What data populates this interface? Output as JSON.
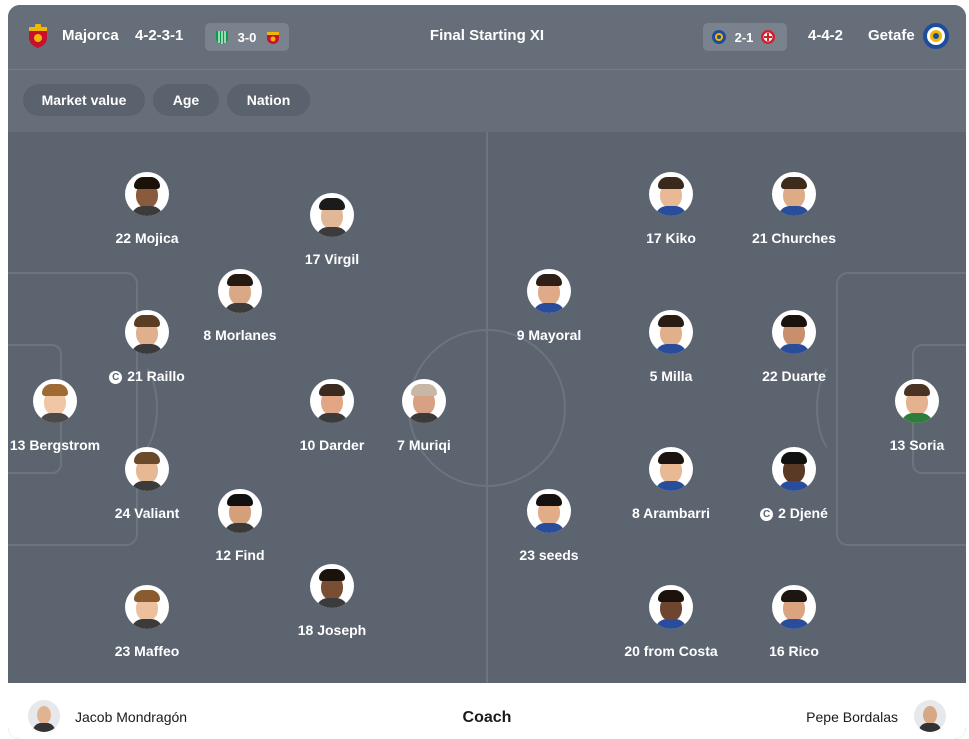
{
  "header": {
    "home_team": "Majorca",
    "home_formation": "4-2-3-1",
    "home_last_score": "3-0",
    "title": "Final Starting XI",
    "away_last_score": "2-1",
    "away_formation": "4-4-2",
    "away_team": "Getafe"
  },
  "filters": [
    "Market value",
    "Age",
    "Nation"
  ],
  "players": [
    {
      "label": "22 Mojica",
      "captain": false
    },
    {
      "label": "17 Virgil",
      "captain": false
    },
    {
      "label": "8 Morlanes",
      "captain": false
    },
    {
      "label": "21 Raillo",
      "captain": true
    },
    {
      "label": "13 Bergstrom",
      "captain": false
    },
    {
      "label": "10 Darder",
      "captain": false
    },
    {
      "label": "7 Muriqi",
      "captain": false
    },
    {
      "label": "24 Valiant",
      "captain": false
    },
    {
      "label": "12 Find",
      "captain": false
    },
    {
      "label": "23 Maffeo",
      "captain": false
    },
    {
      "label": "18 Joseph",
      "captain": false
    },
    {
      "label": "17 Kiko",
      "captain": false
    },
    {
      "label": "21 Churches",
      "captain": false
    },
    {
      "label": "9 Mayoral",
      "captain": false
    },
    {
      "label": "5 Milla",
      "captain": false
    },
    {
      "label": "22 Duarte",
      "captain": false
    },
    {
      "label": "13 Soria",
      "captain": false
    },
    {
      "label": "8 Arambarri",
      "captain": false
    },
    {
      "label": "2 Djené",
      "captain": true
    },
    {
      "label": "23 seeds",
      "captain": false
    },
    {
      "label": "20 from Costa",
      "captain": false
    },
    {
      "label": "16 Rico",
      "captain": false
    }
  ],
  "captain_mark": "C",
  "footer": {
    "home_coach": "Jacob Mondragón",
    "title": "Coach",
    "away_coach": "Pepe Bordalas"
  },
  "icons": {
    "home_crest": "majorca-crest-icon",
    "away_crest": "getafe-crest-icon",
    "opponent_crests": [
      "betis-crest-icon",
      "majorca-crest-icon",
      "getafe-crest-icon",
      "girona-crest-icon"
    ]
  },
  "colors": {
    "pitch": "#5c6470",
    "header": "#666e7a",
    "majorca_red": "#c8102e",
    "majorca_gold": "#f2b705",
    "getafe_blue": "#1d4d9b",
    "girona_red": "#d0202e",
    "betis_green": "#0b9b4a"
  }
}
